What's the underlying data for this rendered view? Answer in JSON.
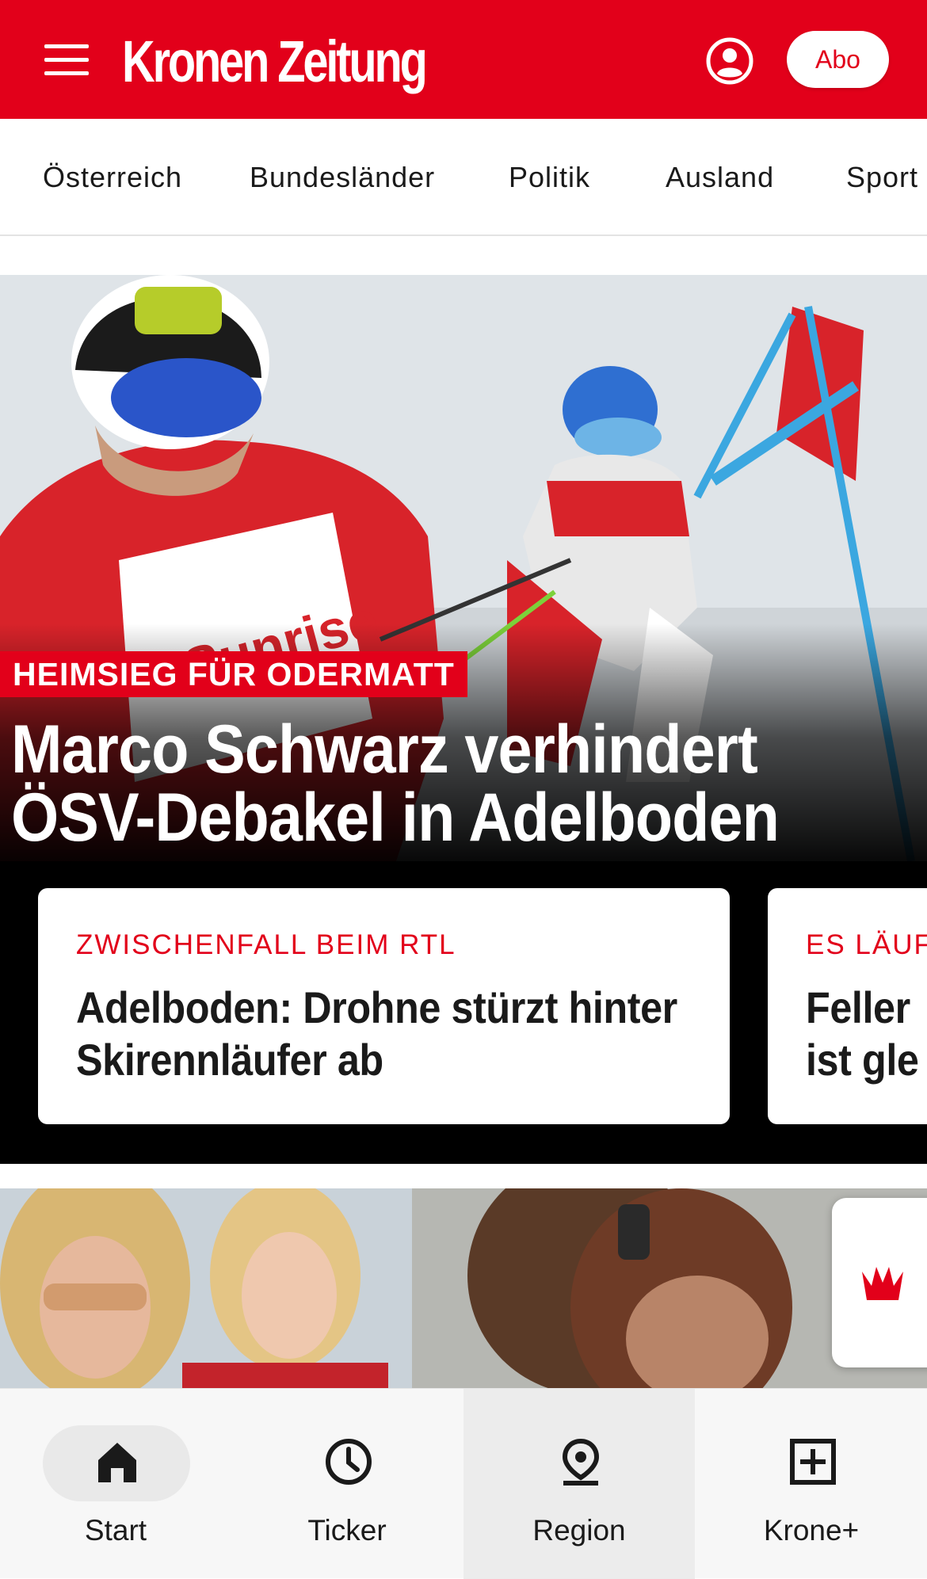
{
  "header": {
    "logo": "Kronen Zeitung",
    "abo_label": "Abo"
  },
  "categories": [
    "Österreich",
    "Bundesländer",
    "Politik",
    "Ausland",
    "Sport"
  ],
  "hero": {
    "kicker": "HEIMSIEG FÜR ODERMATT",
    "title": "Marco Schwarz verhindert ÖSV-Debakel in Adelboden"
  },
  "cards": [
    {
      "kicker": "ZWISCHENFALL BEIM RTL",
      "title": "Adelboden: Drohne stürzt hinter Skirennläufer ab"
    },
    {
      "kicker": "ES LÄUF",
      "title": "Feller ist gle"
    }
  ],
  "bottom_nav": [
    {
      "label": "Start",
      "icon": "home-icon"
    },
    {
      "label": "Ticker",
      "icon": "clock-icon"
    },
    {
      "label": "Region",
      "icon": "location-pin-icon"
    },
    {
      "label": "Krone+",
      "icon": "plus-square-icon"
    }
  ],
  "colors": {
    "brand_red": "#e2001a",
    "text_dark": "#1a1a1a",
    "nav_bg": "#f7f7f7"
  }
}
